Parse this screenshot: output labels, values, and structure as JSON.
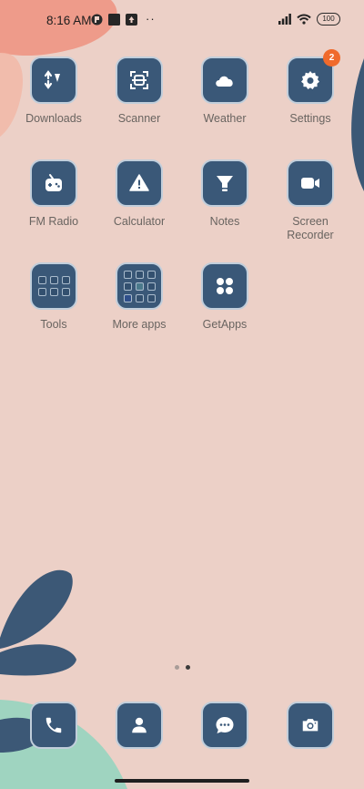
{
  "status_bar": {
    "time": "8:16 AM",
    "battery": "100",
    "more": "··"
  },
  "apps": [
    {
      "label": "Downloads",
      "icon": "downloads-icon"
    },
    {
      "label": "Scanner",
      "icon": "scanner-icon"
    },
    {
      "label": "Weather",
      "icon": "weather-icon"
    },
    {
      "label": "Settings",
      "icon": "gear-icon",
      "badge": "2"
    },
    {
      "label": "FM Radio",
      "icon": "radio-icon"
    },
    {
      "label": "Calculator",
      "icon": "calculator-icon"
    },
    {
      "label": "Notes",
      "icon": "notes-icon"
    },
    {
      "label": "Screen Recorder",
      "label_line1": "Screen",
      "label_line2": "Recorder",
      "icon": "video-camera-icon"
    },
    {
      "label": "Tools",
      "icon": "folder-icon"
    },
    {
      "label": "More apps",
      "icon": "folder-icon"
    },
    {
      "label": "GetApps",
      "icon": "getapps-icon"
    }
  ],
  "dock": [
    {
      "name": "Phone",
      "icon": "phone-icon"
    },
    {
      "name": "Contacts",
      "icon": "contacts-icon"
    },
    {
      "name": "Messages",
      "icon": "message-icon"
    },
    {
      "name": "Camera",
      "icon": "camera-icon"
    }
  ],
  "pages": {
    "count": 2,
    "active": 2
  },
  "colors": {
    "background": "#ecd0c7",
    "icon_fill": "#3a5878",
    "icon_border": "#c1cedb",
    "badge": "#f06a2c",
    "accent_coral": "#ee9b8a",
    "accent_navy": "#3c5876",
    "accent_mint": "#9fd4c0"
  }
}
